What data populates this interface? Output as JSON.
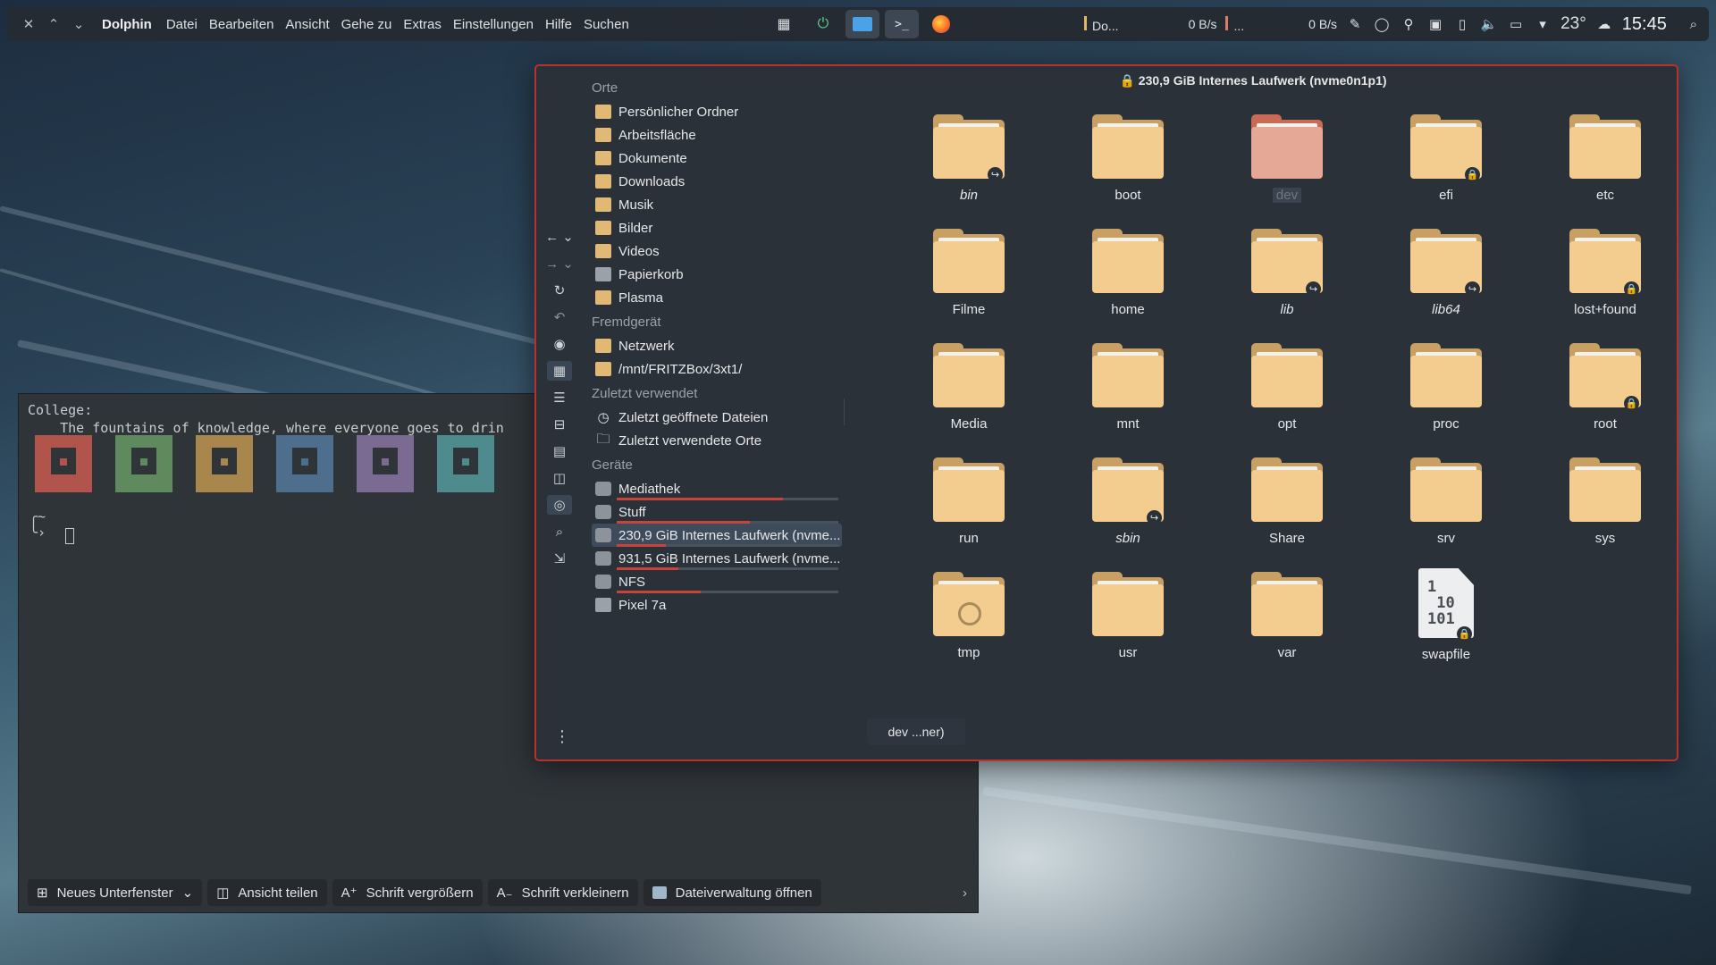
{
  "panel": {
    "app_name": "Dolphin",
    "menu": [
      "Datei",
      "Bearbeiten",
      "Ansicht",
      "Gehe zu",
      "Extras",
      "Einstellungen",
      "Hilfe",
      "Suchen"
    ],
    "task_label": "Do...",
    "net_down": "0 B/s",
    "net_ellipsis": "...",
    "net_up": "0 B/s",
    "temperature": "23°",
    "clock": "15:45"
  },
  "konsole": {
    "line1": "College:",
    "line2": "    The fountains of knowledge, where everyone goes to drin",
    "prompt": "~",
    "block_colors": [
      "#b0544c",
      "#5f8a5e",
      "#a9864c",
      "#4e6e8e",
      "#7b6b92",
      "#4e8b8c"
    ],
    "toolbar": {
      "new_tab": "Neues Unterfenster",
      "split": "Ansicht teilen",
      "bigger": "Schrift vergrößern",
      "smaller": "Schrift verkleinern",
      "filemgr": "Dateiverwaltung öffnen"
    }
  },
  "dolphin": {
    "location_title": "230,9 GiB Internes Laufwerk (nvme0n1p1)",
    "status_text": "dev ...ner)",
    "places": {
      "sec_places": "Orte",
      "places": [
        "Persönlicher Ordner",
        "Arbeitsfläche",
        "Dokumente",
        "Downloads",
        "Musik",
        "Bilder",
        "Videos",
        "Papierkorb",
        "Plasma"
      ],
      "sec_remote": "Fremdgerät",
      "remote": [
        "Netzwerk",
        "/mnt/FRITZBox/3xt1/"
      ],
      "sec_recent": "Zuletzt verwendet",
      "recent": [
        "Zuletzt geöffnete Dateien",
        "Zuletzt verwendete Orte"
      ],
      "sec_devices": "Geräte",
      "devices": [
        "Mediathek",
        "Stuff",
        "230,9 GiB Internes Laufwerk (nvme...",
        "931,5 GiB Internes Laufwerk (nvme...",
        "NFS",
        "Pixel 7a"
      ],
      "device_usage": [
        0.75,
        0.6,
        0.22,
        0.28,
        0.38
      ]
    },
    "files": [
      "bin",
      "boot",
      "dev",
      "efi",
      "etc",
      "Filme",
      "home",
      "lib",
      "lib64",
      "lost+found",
      "Media",
      "mnt",
      "opt",
      "proc",
      "root",
      "run",
      "sbin",
      "Share",
      "srv",
      "sys",
      "tmp",
      "usr",
      "var",
      "swapfile"
    ],
    "swap_glyph": "1\n 10\n101"
  }
}
